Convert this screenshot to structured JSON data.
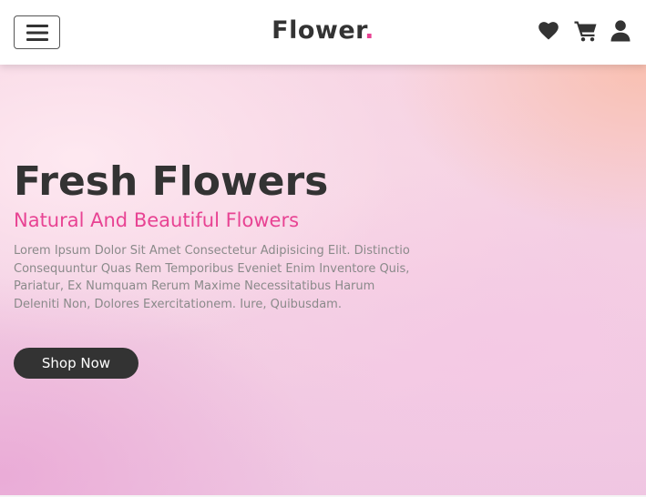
{
  "header": {
    "logo_text": "Flower",
    "logo_dot": ".",
    "icons": [
      "menu-icon",
      "heart-icon",
      "cart-icon",
      "user-icon"
    ]
  },
  "hero": {
    "title": "Fresh Flowers",
    "subtitle": "Natural And Beautiful Flowers",
    "description": "Lorem Ipsum Dolor Sit Amet Consectetur Adipisicing Elit. Distinctio Consequuntur Quas Rem Temporibus Eveniet Enim Inventore Quis, Pariatur, Ex Numquam Rerum Maxime Necessitatibus Harum Deleniti Non, Dolores Exercitationem. Iure, Quibusdam.",
    "button_label": "Shop Now"
  },
  "colors": {
    "accent": "#e84393",
    "dark": "#333333",
    "muted_text": "#8a8a8a",
    "header_bg": "#ffffff"
  }
}
